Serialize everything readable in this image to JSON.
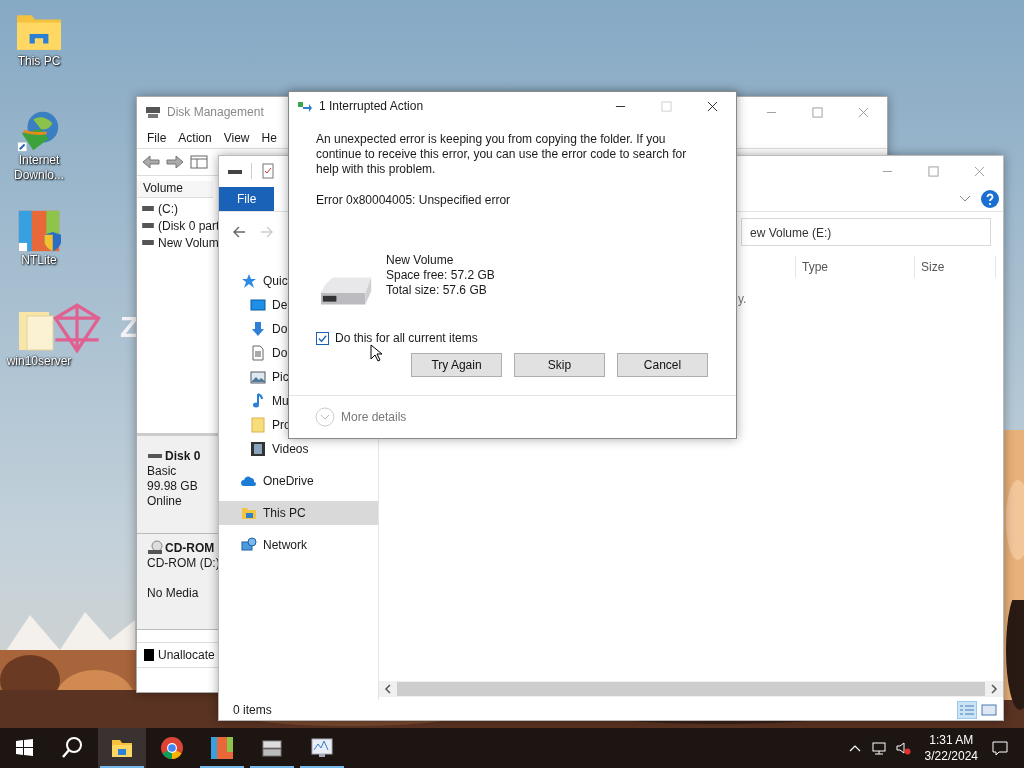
{
  "desktop": {
    "icons": [
      {
        "kind": "pc-folder",
        "label": "This PC"
      },
      {
        "kind": "downloader",
        "label": "Internet Downlo..."
      },
      {
        "kind": "ntlite",
        "label": "NTLite"
      },
      {
        "kind": "folder-z",
        "label": "win10server",
        "logo_text": "Z"
      }
    ]
  },
  "disk_management": {
    "title": "Disk Management",
    "menu": [
      "File",
      "Action",
      "View",
      "He"
    ],
    "volume_header": "Volume",
    "volumes": [
      "(C:)",
      "(Disk 0 part",
      "New Volum"
    ],
    "disks": [
      {
        "kind": "disk",
        "name": "Disk 0",
        "lines": [
          "Basic",
          "99.98 GB",
          "Online"
        ]
      },
      {
        "kind": "cdrom",
        "name": "CD-ROM",
        "lines": [
          "CD-ROM (D:)",
          "No Media"
        ]
      }
    ],
    "legend": [
      {
        "label": "Unallocate",
        "color": "#000000"
      }
    ]
  },
  "explorer": {
    "ribbon_tabs": [
      {
        "label": "File",
        "selected": true
      }
    ],
    "address": "ew Volume (E:)",
    "columns": [
      "Type",
      "Size"
    ],
    "empty_message": "y.",
    "nav": [
      {
        "kind": "star",
        "label": "Quic",
        "selected": false,
        "children": [
          {
            "kind": "desktop",
            "label": "De",
            "selected": false
          },
          {
            "kind": "download",
            "label": "Do",
            "selected": false
          },
          {
            "kind": "document",
            "label": "Do",
            "selected": false
          },
          {
            "kind": "picture",
            "label": "Pic",
            "selected": false
          },
          {
            "kind": "music",
            "label": "Mu",
            "selected": false
          },
          {
            "kind": "folder",
            "label": "Pro",
            "selected": false
          },
          {
            "kind": "video",
            "label": "Videos",
            "selected": false
          }
        ]
      },
      {
        "kind": "cloud",
        "label": "OneDrive",
        "selected": false
      },
      {
        "kind": "pc",
        "label": "This PC",
        "selected": true
      },
      {
        "kind": "network",
        "label": "Network",
        "selected": false
      }
    ],
    "status": "0 items",
    "views": [
      {
        "kind": "details",
        "selected": true
      },
      {
        "kind": "tiles",
        "selected": false
      }
    ]
  },
  "dialog": {
    "title": "1 Interrupted Action",
    "message": "An unexpected error is keeping you from copying the folder. If you continue to receive this error, you can use the error code to search for help with this problem.",
    "error": "Error 0x80004005: Unspecified error",
    "drive": {
      "name": "New Volume",
      "free": "Space free: 57.2 GB",
      "total": "Total size: 57.6 GB"
    },
    "checkbox": {
      "label": "Do this for all current items",
      "checked": true
    },
    "buttons": [
      "Try Again",
      "Skip",
      "Cancel"
    ],
    "more_details": "More details"
  },
  "taskbar": {
    "apps": [
      {
        "kind": "explorer",
        "running": true,
        "active": true
      },
      {
        "kind": "chrome",
        "running": false,
        "active": false
      },
      {
        "kind": "ntlite",
        "running": true,
        "active": false
      },
      {
        "kind": "drives",
        "running": true,
        "active": false
      },
      {
        "kind": "monitor",
        "running": true,
        "active": false
      }
    ],
    "time": "1:31 AM",
    "date": "3/22/2024"
  }
}
